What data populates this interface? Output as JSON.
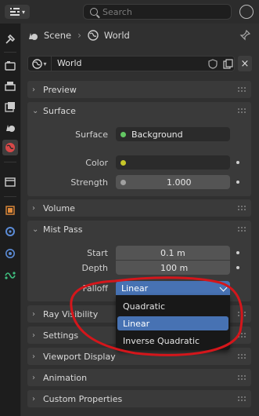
{
  "header": {
    "search_placeholder": "Search",
    "editor_type_icon": "properties-icon"
  },
  "sidebar": {
    "tabs": [
      {
        "name": "tool-icon",
        "active": false
      },
      {
        "name": "render-icon",
        "active": false
      },
      {
        "name": "output-icon",
        "active": false
      },
      {
        "name": "view-layer-icon",
        "active": false
      },
      {
        "name": "scene-icon",
        "active": false
      },
      {
        "name": "world-icon",
        "active": true
      },
      {
        "name": "collection-icon",
        "active": false
      },
      {
        "name": "object-icon",
        "active": false
      },
      {
        "name": "modifier-icon",
        "active": false
      },
      {
        "name": "physics-icon",
        "active": false
      },
      {
        "name": "object-data-icon",
        "active": false
      }
    ]
  },
  "breadcrumb": {
    "scene": "Scene",
    "world": "World"
  },
  "datablock": {
    "name": "World"
  },
  "panels": {
    "preview": "Preview",
    "surface": "Surface",
    "volume": "Volume",
    "mist_pass": "Mist Pass",
    "ray_visibility": "Ray Visibility",
    "settings": "Settings",
    "viewport_display": "Viewport Display",
    "animation": "Animation",
    "custom_properties": "Custom Properties"
  },
  "surface": {
    "surface_label": "Surface",
    "surface_value": "Background",
    "color_label": "Color",
    "strength_label": "Strength",
    "strength_value": "1.000"
  },
  "mist": {
    "start_label": "Start",
    "start_value": "0.1 m",
    "depth_label": "Depth",
    "depth_value": "100 m",
    "falloff_label": "Falloff",
    "falloff_value": "Linear",
    "falloff_options": [
      "Quadratic",
      "Linear",
      "Inverse Quadratic"
    ],
    "falloff_selected": "Linear"
  },
  "colors": {
    "accent": "#4772b3",
    "annotation": "#d4161b",
    "socket_green": "#63c763",
    "socket_yellow": "#c7c729"
  }
}
